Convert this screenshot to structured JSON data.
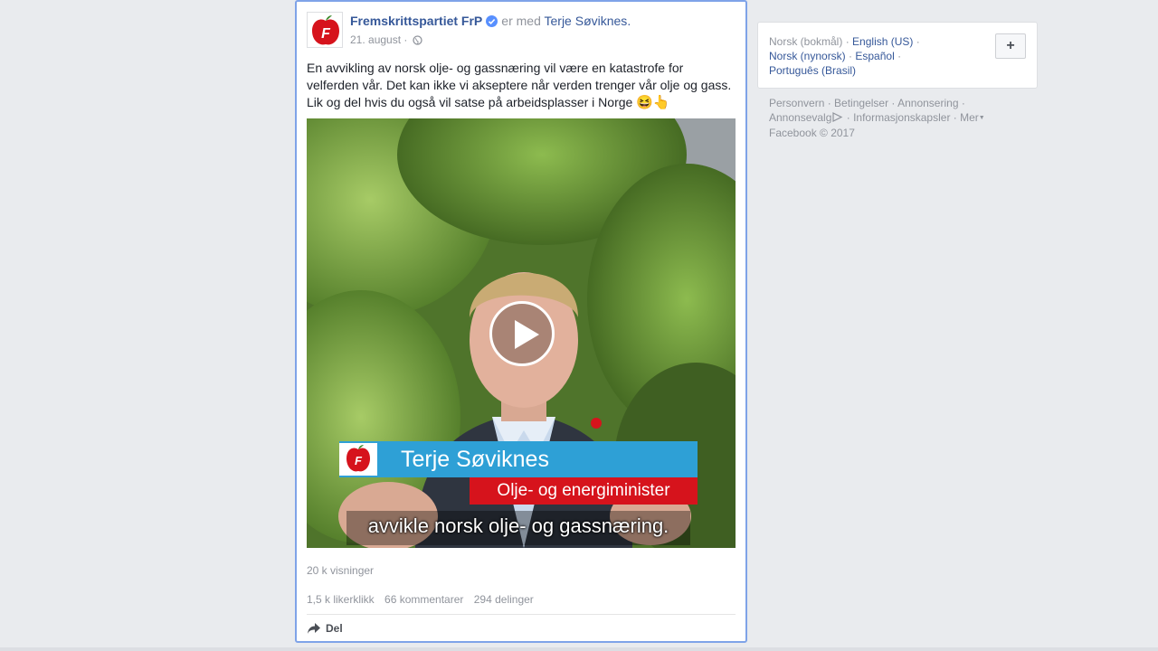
{
  "post": {
    "page_name": "Fremskrittspartiet FrP",
    "with_text": "er med",
    "tagged_name": "Terje Søviknes",
    "tagged_suffix": ".",
    "date": "21. august",
    "date_sep": "·",
    "text": "En avvikling av norsk olje- og gassnæring vil være en katastrofe for velferden vår. Det kan ikke vi akseptere når verden trenger vår olje og gass. Lik og del hvis du også vil satse på arbeidsplasser i Norge",
    "emoji": "😆👆",
    "video": {
      "lower_third_name": "Terje Søviknes",
      "lower_third_role": "Olje- og energiminister",
      "subtitle": "avvikle norsk olje- og gassnæring.",
      "logo_letter": "F"
    },
    "views": "20 k visninger",
    "likes": "1,5 k likerklikk",
    "comments": "66 kommentarer",
    "shares": "294 delinger",
    "share_label": "Del"
  },
  "languages": {
    "current": "Norsk (bokmål)",
    "items": [
      "English (US)",
      "Norsk (nynorsk)",
      "Español",
      "Português (Brasil)"
    ],
    "add_label": "+"
  },
  "footer": {
    "links": [
      "Personvern",
      "Betingelser",
      "Annonsering",
      "Annonsevalg",
      "Informasjonskapsler",
      "Mer"
    ],
    "copyright": "Facebook © 2017"
  },
  "colors": {
    "link": "#365899",
    "muted": "#90949c",
    "frp_red": "#d6131c",
    "frp_blue": "#2ea0d6",
    "post_border": "#7fa3e8"
  }
}
